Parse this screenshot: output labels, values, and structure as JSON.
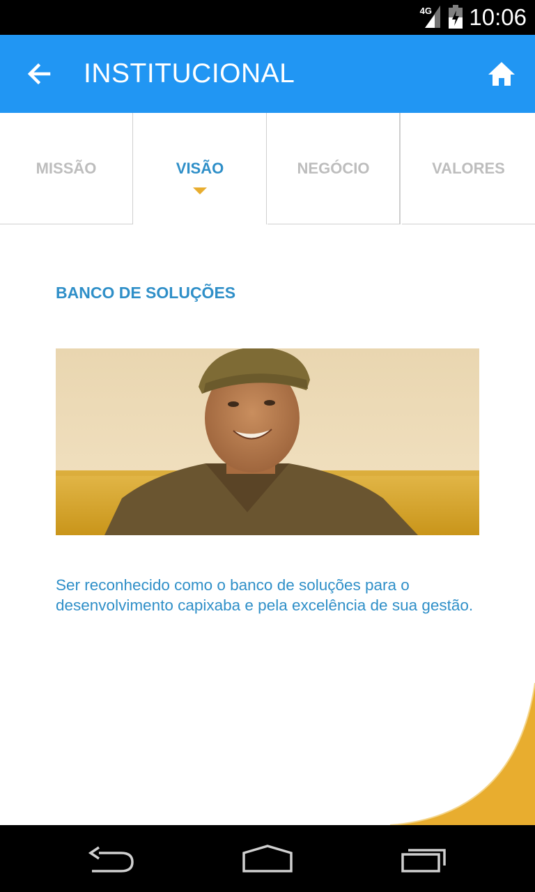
{
  "status_bar": {
    "network": "4G",
    "time": "10:06"
  },
  "app_bar": {
    "title": "INSTITUCIONAL",
    "back_icon": "arrow-back-icon",
    "home_icon": "home-icon",
    "color": "#2196f3"
  },
  "tabs": [
    {
      "label": "MISSÃO",
      "selected": false
    },
    {
      "label": "VISÃO",
      "selected": true
    },
    {
      "label": "NEGÓCIO",
      "selected": false
    },
    {
      "label": "VALORES",
      "selected": false
    }
  ],
  "content": {
    "heading": "BANCO DE SOLUÇÕES",
    "image_description_icon": "farmer-photo",
    "body": "Ser reconhecido como o banco de soluções para o desenvolvimento capixaba e pela excelência de sua gestão."
  },
  "colors": {
    "accent_blue": "#2f8fc8",
    "accent_gold": "#e8ad2f",
    "inactive_tab": "#bdbdbd"
  },
  "nav_bar": {
    "back_icon": "nav-back-icon",
    "home_icon": "nav-home-icon",
    "recents_icon": "nav-recents-icon"
  }
}
